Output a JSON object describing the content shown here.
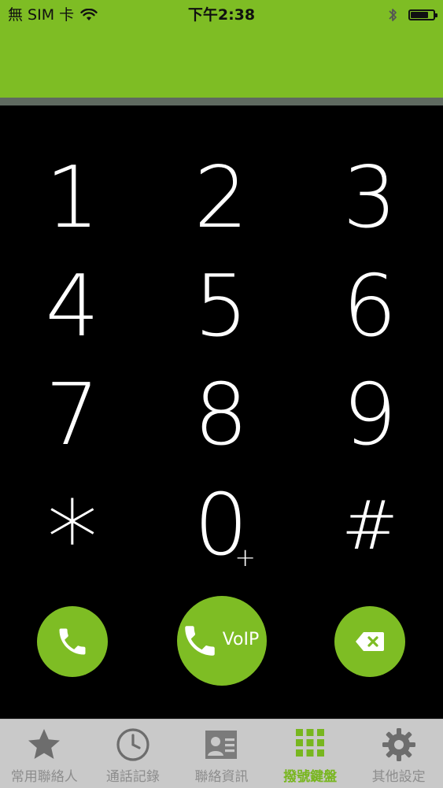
{
  "status_bar": {
    "carrier": "無 SIM 卡",
    "time": "下午2:38",
    "battery_level": 0.85
  },
  "keypad": {
    "keys": [
      "1",
      "2",
      "3",
      "4",
      "5",
      "6",
      "7",
      "8",
      "9",
      "*",
      "0",
      "#"
    ],
    "zero_plus": "+"
  },
  "actions": {
    "voip_label": "VoIP"
  },
  "tabs": [
    {
      "label": "常用聯絡人",
      "icon": "star-icon",
      "active": false
    },
    {
      "label": "通話記錄",
      "icon": "clock-icon",
      "active": false
    },
    {
      "label": "聯絡資訊",
      "icon": "contact-card-icon",
      "active": false
    },
    {
      "label": "撥號鍵盤",
      "icon": "keypad-icon",
      "active": true
    },
    {
      "label": "其他設定",
      "icon": "gear-icon",
      "active": false
    }
  ],
  "colors": {
    "accent": "#7ebd24",
    "background": "#000000",
    "tabbar": "#c9c9c9"
  }
}
